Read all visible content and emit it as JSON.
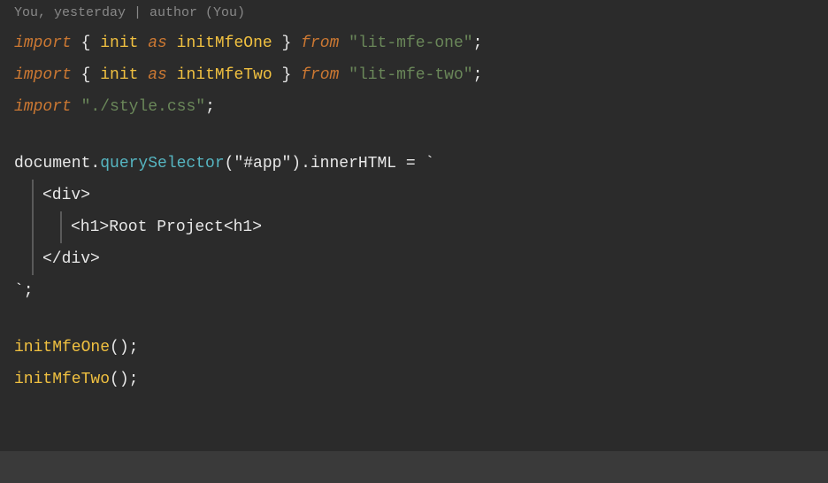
{
  "meta": {
    "text": "You, yesterday | author (You)"
  },
  "lines": [
    {
      "id": "line1",
      "tokens": [
        {
          "type": "kw-import",
          "text": "import"
        },
        {
          "type": "plain",
          "text": " { "
        },
        {
          "type": "func-name",
          "text": "init"
        },
        {
          "type": "plain",
          "text": " "
        },
        {
          "type": "kw-as",
          "text": "as"
        },
        {
          "type": "plain",
          "text": " "
        },
        {
          "type": "func-name",
          "text": "initMfeOne"
        },
        {
          "type": "plain",
          "text": " } "
        },
        {
          "type": "kw-from",
          "text": "from"
        },
        {
          "type": "plain",
          "text": " "
        },
        {
          "type": "string",
          "text": "\"lit-mfe-one\""
        },
        {
          "type": "plain",
          "text": ";"
        }
      ],
      "indent": 0
    },
    {
      "id": "line2",
      "tokens": [
        {
          "type": "kw-import",
          "text": "import"
        },
        {
          "type": "plain",
          "text": " { "
        },
        {
          "type": "func-name",
          "text": "init"
        },
        {
          "type": "plain",
          "text": " "
        },
        {
          "type": "kw-as",
          "text": "as"
        },
        {
          "type": "plain",
          "text": " "
        },
        {
          "type": "func-name",
          "text": "initMfeTwo"
        },
        {
          "type": "plain",
          "text": " } "
        },
        {
          "type": "kw-from",
          "text": "from"
        },
        {
          "type": "plain",
          "text": " "
        },
        {
          "type": "string",
          "text": "\"lit-mfe-two\""
        },
        {
          "type": "plain",
          "text": ";"
        }
      ],
      "indent": 0
    },
    {
      "id": "line3",
      "tokens": [
        {
          "type": "kw-import",
          "text": "import"
        },
        {
          "type": "plain",
          "text": " "
        },
        {
          "type": "string",
          "text": "\"./style.css\""
        },
        {
          "type": "plain",
          "text": ";"
        }
      ],
      "indent": 0
    },
    {
      "id": "line-empty1",
      "tokens": [],
      "indent": 0,
      "empty": true
    },
    {
      "id": "line4",
      "tokens": [
        {
          "type": "plain",
          "text": "document."
        },
        {
          "type": "method",
          "text": "querySelector"
        },
        {
          "type": "plain",
          "text": "(\"#app\").innerHTML = `"
        }
      ],
      "indent": 0
    },
    {
      "id": "line5",
      "tokens": [
        {
          "type": "plain",
          "text": "<div>"
        }
      ],
      "indent": 1
    },
    {
      "id": "line6",
      "tokens": [
        {
          "type": "plain",
          "text": "<h1>Root Project<h1>"
        }
      ],
      "indent": 2
    },
    {
      "id": "line7",
      "tokens": [
        {
          "type": "plain",
          "text": "</div>"
        }
      ],
      "indent": 1
    },
    {
      "id": "line8",
      "tokens": [
        {
          "type": "plain",
          "text": "`;"
        }
      ],
      "indent": 0
    },
    {
      "id": "line-empty2",
      "tokens": [],
      "indent": 0,
      "empty": true
    },
    {
      "id": "line9",
      "tokens": [
        {
          "type": "func-call",
          "text": "initMfeOne"
        },
        {
          "type": "plain",
          "text": "();"
        }
      ],
      "indent": 0
    },
    {
      "id": "line10",
      "tokens": [
        {
          "type": "func-call",
          "text": "initMfeTwo"
        },
        {
          "type": "plain",
          "text": "();"
        }
      ],
      "indent": 0
    }
  ],
  "colors": {
    "background": "#2b2b2b",
    "bottomBar": "#3a3a3a",
    "meta": "#888888"
  }
}
